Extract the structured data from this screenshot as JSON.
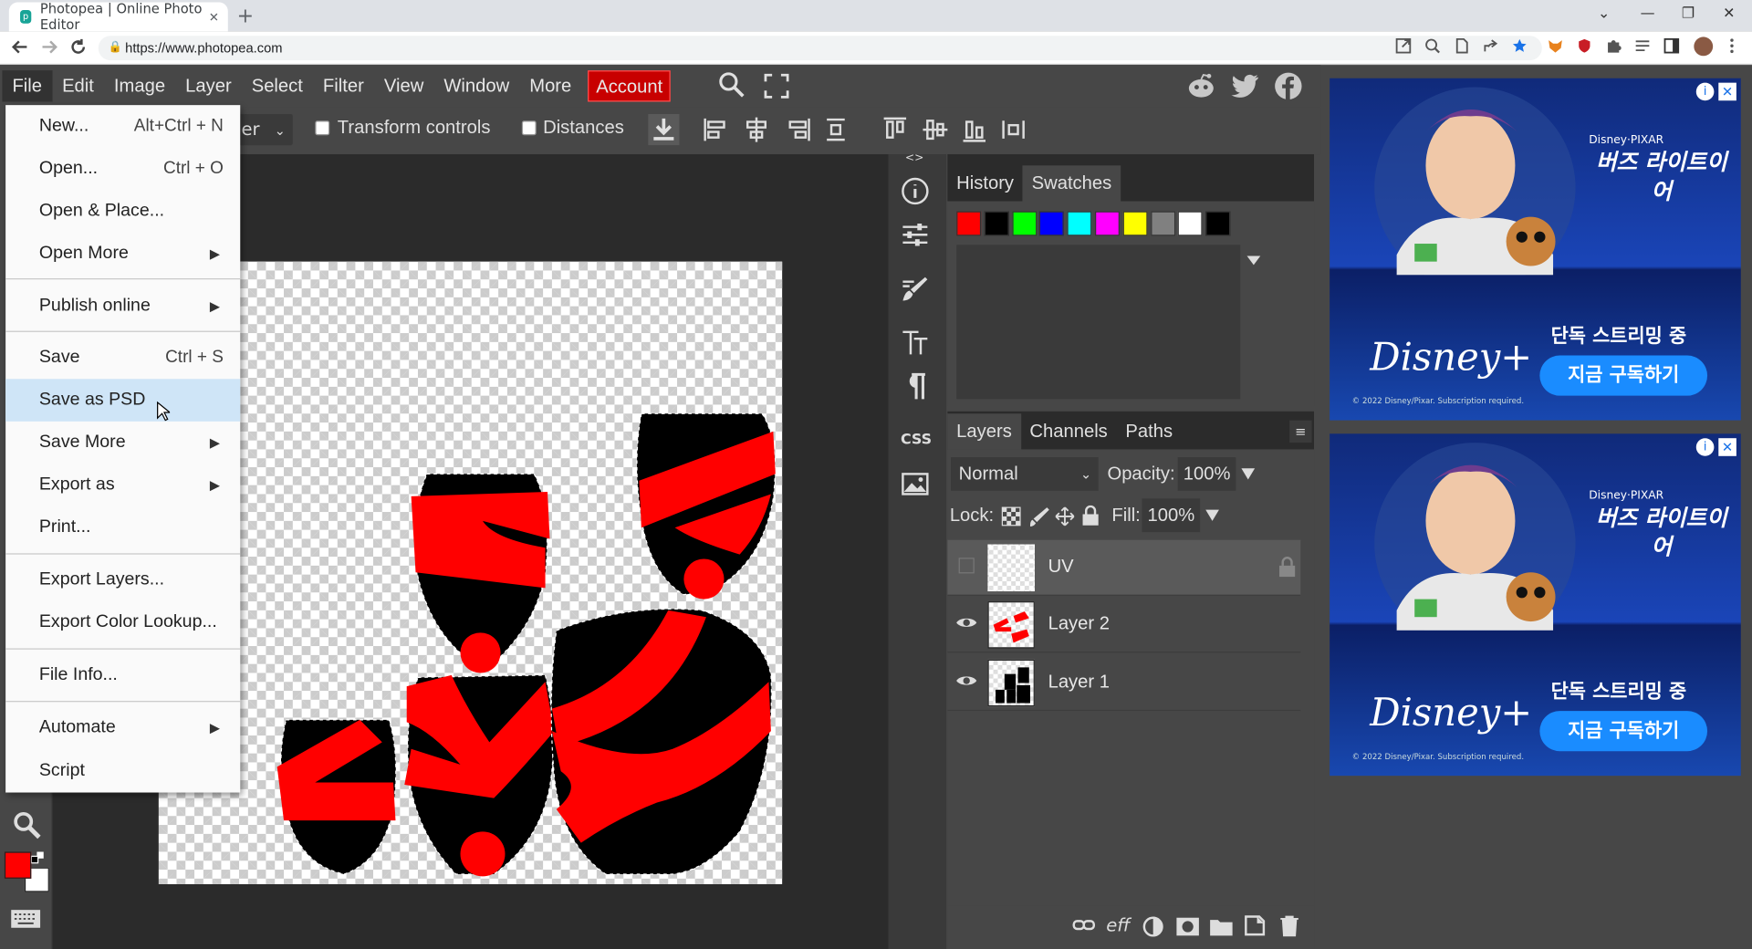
{
  "browser": {
    "tab_title": "Photopea | Online Photo Editor",
    "url": "https://www.photopea.com",
    "new_tab_glyph": "+",
    "tab_close_glyph": "✕",
    "window_controls": [
      "⌄",
      "—",
      "❐",
      "✕"
    ],
    "nav_icons": [
      "back-icon",
      "forward-icon",
      "reload-icon",
      "lock-icon"
    ],
    "extension_icons": [
      "open-in-app-icon",
      "zoom-icon",
      "page-icon",
      "share-icon",
      "bookmark-star-icon",
      "fox-extension-icon",
      "shield-extension-icon",
      "puzzle-icon",
      "reading-list-icon",
      "sidepanel-icon",
      "profile-avatar-icon",
      "kebab-menu-icon"
    ]
  },
  "menubar": {
    "items": [
      "File",
      "Edit",
      "Image",
      "Layer",
      "Select",
      "Filter",
      "View",
      "Window",
      "More",
      "Account"
    ],
    "social": [
      "reddit-icon",
      "twitter-icon",
      "facebook-icon"
    ]
  },
  "optionsbar": {
    "dropdown_text": "er",
    "transform_controls": "Transform controls",
    "distances": "Distances"
  },
  "file_menu": {
    "items": [
      {
        "label": "New...",
        "shortcut": "Alt+Ctrl + N",
        "submenu": false
      },
      {
        "label": "Open...",
        "shortcut": "Ctrl + O",
        "submenu": false
      },
      {
        "label": "Open & Place...",
        "shortcut": "",
        "submenu": false
      },
      {
        "label": "Open More",
        "shortcut": "",
        "submenu": true
      },
      {
        "label": "Publish online",
        "shortcut": "",
        "submenu": true
      },
      {
        "label": "Save",
        "shortcut": "Ctrl + S",
        "submenu": false
      },
      {
        "label": "Save as PSD",
        "shortcut": "",
        "submenu": false,
        "highlighted": true
      },
      {
        "label": "Save More",
        "shortcut": "",
        "submenu": true
      },
      {
        "label": "Export as",
        "shortcut": "",
        "submenu": true
      },
      {
        "label": "Print...",
        "shortcut": "",
        "submenu": false
      },
      {
        "label": "Export Layers...",
        "shortcut": "",
        "submenu": false
      },
      {
        "label": "Export Color Lookup...",
        "shortcut": "",
        "submenu": false
      },
      {
        "label": "File Info...",
        "shortcut": "",
        "submenu": false
      },
      {
        "label": "Automate",
        "shortcut": "",
        "submenu": true
      },
      {
        "label": "Script",
        "shortcut": "",
        "submenu": false
      }
    ],
    "submenu_arrow": "▶"
  },
  "history_panel": {
    "tabs": [
      "History",
      "Swatches"
    ],
    "active_tab": "Swatches",
    "collapse_left": "<>",
    "collapse_right": "><",
    "swatches": [
      "#ff0000",
      "#000000",
      "#00ff00",
      "#0000ff",
      "#00ffff",
      "#ff00ff",
      "#ffff00",
      "#808080",
      "#ffffff",
      "#000000"
    ]
  },
  "layers_panel": {
    "tabs": [
      "Layers",
      "Channels",
      "Paths"
    ],
    "active_tab": "Layers",
    "blend_mode": "Normal",
    "opacity_label": "Opacity:",
    "opacity_value": "100%",
    "lock_label": "Lock:",
    "fill_label": "Fill:",
    "fill_value": "100%",
    "layers": [
      {
        "name": "UV",
        "visible": false,
        "locked": true,
        "selected": true
      },
      {
        "name": "Layer 2",
        "visible": true,
        "locked": false,
        "selected": false
      },
      {
        "name": "Layer 1",
        "visible": true,
        "locked": false,
        "selected": false
      }
    ],
    "footer_icons": [
      "link-icon",
      "effects-icon",
      "adjustment-icon",
      "mask-icon",
      "folder-icon",
      "new-layer-icon",
      "trash-icon"
    ],
    "footer_eff": "eff"
  },
  "side_icons": {
    "css_label": "CSS"
  },
  "ads": [
    {
      "brand": "Disney·PIXAR",
      "title": "버즈 라이트이어",
      "logo": "Disney+",
      "tagline": "단독 스트리밍 중",
      "button": "지금 구독하기",
      "copyright": "© 2022 Disney/Pixar. Subscription required."
    },
    {
      "brand": "Disney·PIXAR",
      "title": "버즈 라이트이어",
      "logo": "Disney+",
      "tagline": "단독 스트리밍 중",
      "button": "지금 구독하기",
      "copyright": "© 2022 Disney/Pixar. Subscription required."
    }
  ],
  "colors": {
    "accent_account": "#c80000",
    "foreground": "#ff0000",
    "background": "#ffffff",
    "menu_highlight": "#cfe5f7"
  }
}
